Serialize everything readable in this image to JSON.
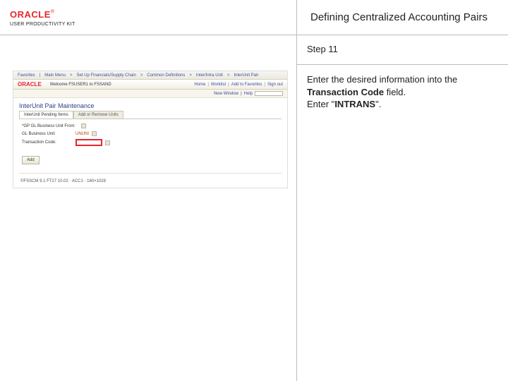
{
  "header": {
    "logo_text": "ORACLE",
    "logo_tm": "®",
    "logo_sub": "USER PRODUCTIVITY KIT",
    "title": "Defining Centralized Accounting Pairs"
  },
  "step": {
    "label": "Step 11",
    "line1_pre": "Enter the desired information into the ",
    "line1_bold": "Transaction Code",
    "line1_post": " field.",
    "line2_pre": "Enter \"",
    "line2_bold": "INTRANS",
    "line2_post": "\"."
  },
  "shot": {
    "nav": {
      "favorites": "Favorites",
      "main_menu": "Main Menu",
      "crumb1": "Set Up Financials/Supply Chain",
      "crumb2": "Common Definitions",
      "crumb3": "Inter/Intra Unit",
      "crumb4": "InterUnit Pair"
    },
    "welcome_user": "Welcome FSUSER1 to FSSAND",
    "mini_logo": "ORACLE",
    "tabs_right": {
      "home": "Home",
      "worklist": "Worklist",
      "add_fav": "Add to Favorites",
      "signout": "Sign out"
    },
    "search": {
      "label": "New Window",
      "help": "Help"
    },
    "page_title": "InterUnit Pair Maintenance",
    "panel_tabs": {
      "active": "InterUnit Pending Items",
      "inactive": "Add or Remove Units"
    },
    "fields": {
      "gl_unit_from_lbl": "*GP GL Business Unit From:",
      "gl_unit_from_val": "",
      "gl_unit_to_lbl": "GL Business Unit:",
      "gl_unit_to_val": "UNUNI",
      "txn_code_lbl": "Transaction Code:",
      "txn_code_val": ""
    },
    "add_btn": "Add",
    "footer": "©FSSCM 9.1 FT27 10.02 · ACC1 · 160×1028"
  }
}
